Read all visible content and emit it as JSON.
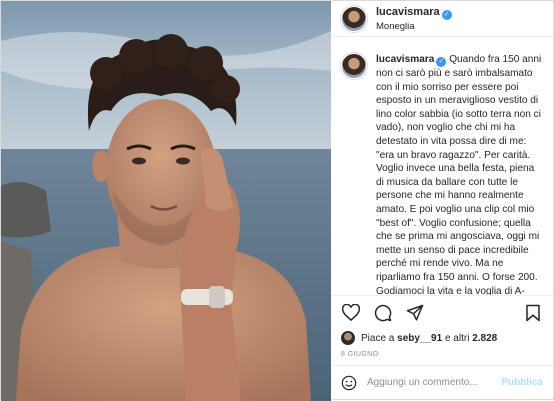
{
  "post": {
    "username": "lucavismara",
    "location": "Moneglia",
    "caption_username": "lucavismara",
    "caption_text": "Quando fra 150 anni\nnon ci sarò più e sarò imbalsamato\ncon il mio sorriso per essere poi\nesposto in un meraviglioso vestito di\nlino color sabbia (io sotto terra non ci\nvado), non voglio che chi mi ha\ndetestato in vita possa dire di me:\n\"era un bravo ragazzo\". Per carità.\nVoglio invece una bella festa, piena\ndi musica da ballare con tutte le\npersone che mi hanno realmente\namato. E poi voglio una clip col mio\n\"best of\". Voglio confusione; quella\nche se prima mi angosciava, oggi mi\nmette un senso di pace incredibile\nperché mi rende vivo. Ma ne\nriparliamo fra 150 anni. O forse 200.\nGodiamoci la vita e la voglia di A-\nMare.",
    "likes_prefix": "Piace a ",
    "likes_user": "seby__91",
    "likes_mid": " e altri ",
    "likes_count": "2.828",
    "date": "8 GIUGNO"
  },
  "icons": {
    "verified": "verified-badge-icon",
    "like": "heart-icon",
    "comment": "comment-icon",
    "share": "paper-plane-icon",
    "save": "bookmark-icon",
    "emoji": "smiley-icon"
  },
  "comment_box": {
    "placeholder": "Aggiungi un commento...",
    "publish_label": "Pubblica"
  },
  "colors": {
    "accent": "#3897f0",
    "publish_disabled": "#b2dffc"
  }
}
